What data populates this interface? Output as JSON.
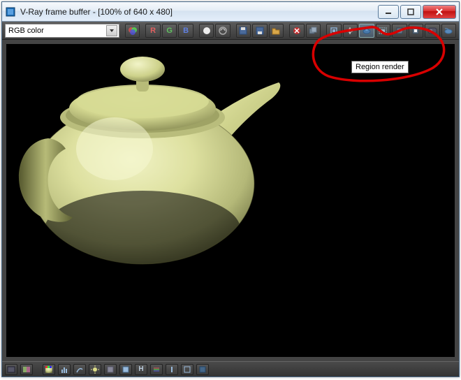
{
  "window": {
    "title": "V-Ray frame buffer - [100% of 640 x 480]"
  },
  "toolbar": {
    "channel_selector": {
      "label": "RGB color"
    },
    "buttons": {
      "swap_channels": "Channels",
      "r": "R",
      "g": "G",
      "b": "B",
      "mono": "Mono",
      "switch": "Switch",
      "save": "Save",
      "load": "Load",
      "open_folder": "Open",
      "clear": "Clear",
      "duplicate": "Duplicate",
      "link_max": "Link",
      "track_mouse": "Track mouse",
      "region_render": "Region render",
      "render_last": "Render last",
      "force_color_clamp": "Clamp",
      "view_clamped": "View clamped",
      "corrections": "Color corrections",
      "vr": "VR"
    }
  },
  "tooltip": {
    "region_render": "Region render"
  },
  "statusbar": {
    "items": [
      "history",
      "compare",
      "color-picker",
      "levels",
      "curve",
      "exposure",
      "white-balance",
      "hue",
      "lut-h",
      "lut-m",
      "stamp",
      "srgb",
      "icc"
    ]
  },
  "colors": {
    "teapot_light": "#e7eab2",
    "teapot_mid": "#c9cf86",
    "teapot_dark": "#7a7d4a",
    "teapot_shadow": "#3b3d22"
  },
  "annotation": {
    "stroke": "#d80000"
  }
}
